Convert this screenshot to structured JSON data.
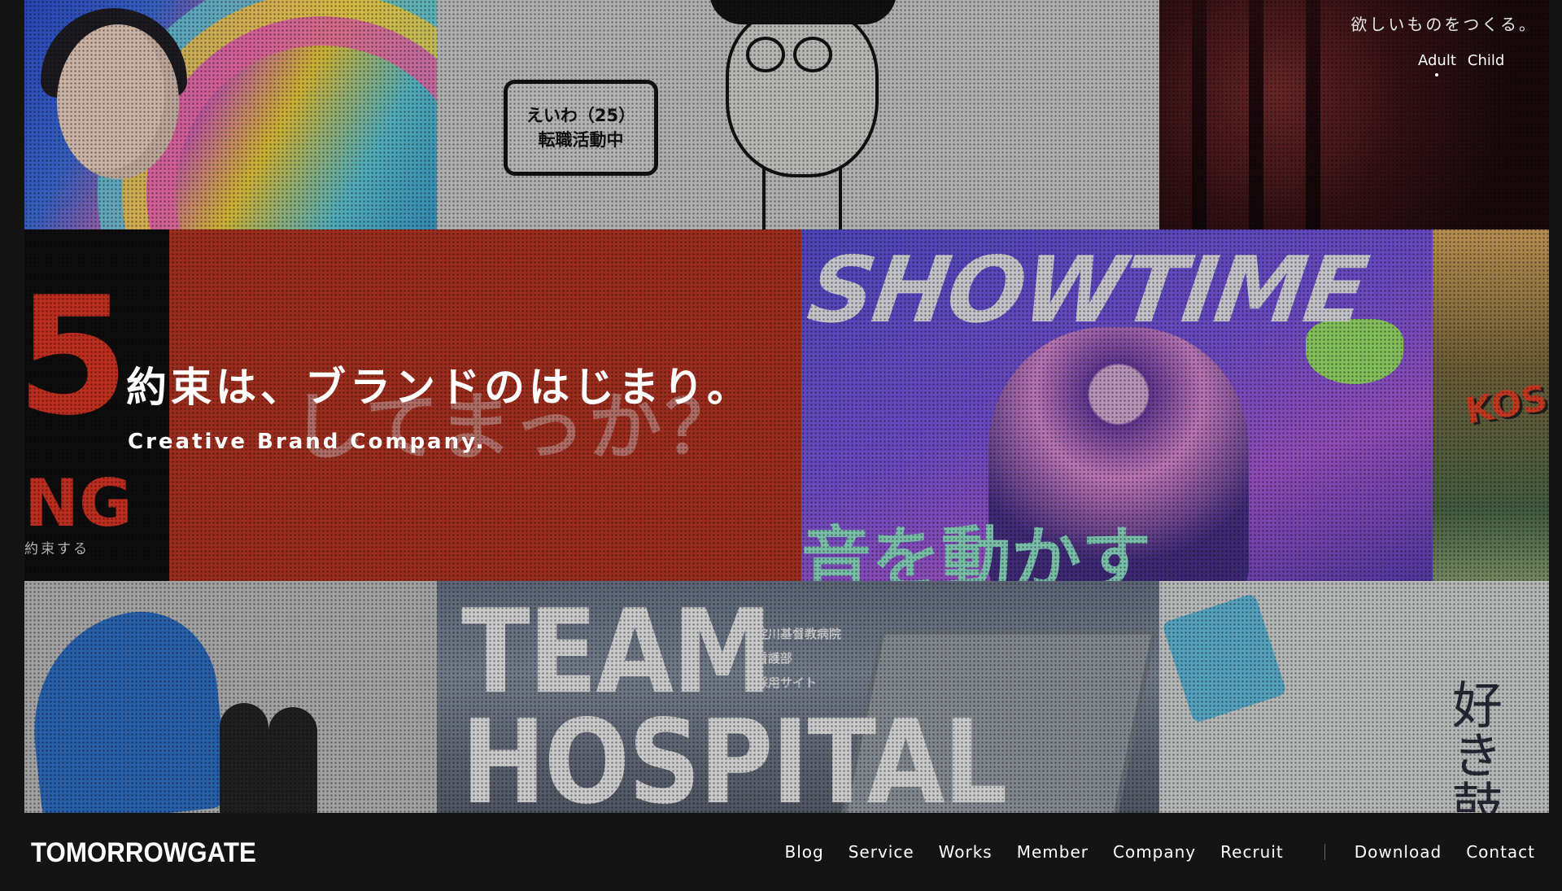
{
  "hero": {
    "headline": "約束は、ブランドのはじまり。",
    "tagline": "Creative Brand Company.",
    "catchphrase": "欲しいものをつくる。"
  },
  "mode_switch": {
    "items": [
      {
        "label": "Adult",
        "active": true
      },
      {
        "label": "Child",
        "active": false
      }
    ]
  },
  "tiles": {
    "cartoon_bubble_line1": "えいわ（25）",
    "cartoon_bubble_line2": "転職活動中",
    "black_big": "5",
    "black_ng": "NG",
    "black_small": "約束する",
    "red_ghost": "してまっか？",
    "purple_title": "SHOWTIME",
    "purple_kanji": "音を動かす",
    "green_text": "KOS",
    "team_line1": "TEAM",
    "team_line2": "HOSPITAL",
    "team_sub1": "淀川基督教病院",
    "team_sub2": "看護部",
    "team_sub3": "採用サイト",
    "sketch_kanji": "好き鼓動"
  },
  "footer": {
    "logo": "TOMORROWGATE",
    "nav": [
      "Blog",
      "Service",
      "Works",
      "Member",
      "Company",
      "Recruit"
    ],
    "nav_secondary": [
      "Download",
      "Contact"
    ]
  },
  "colors": {
    "background": "#141414",
    "red_tile": "#b8321f",
    "purple_tile": "#7a55e2"
  }
}
